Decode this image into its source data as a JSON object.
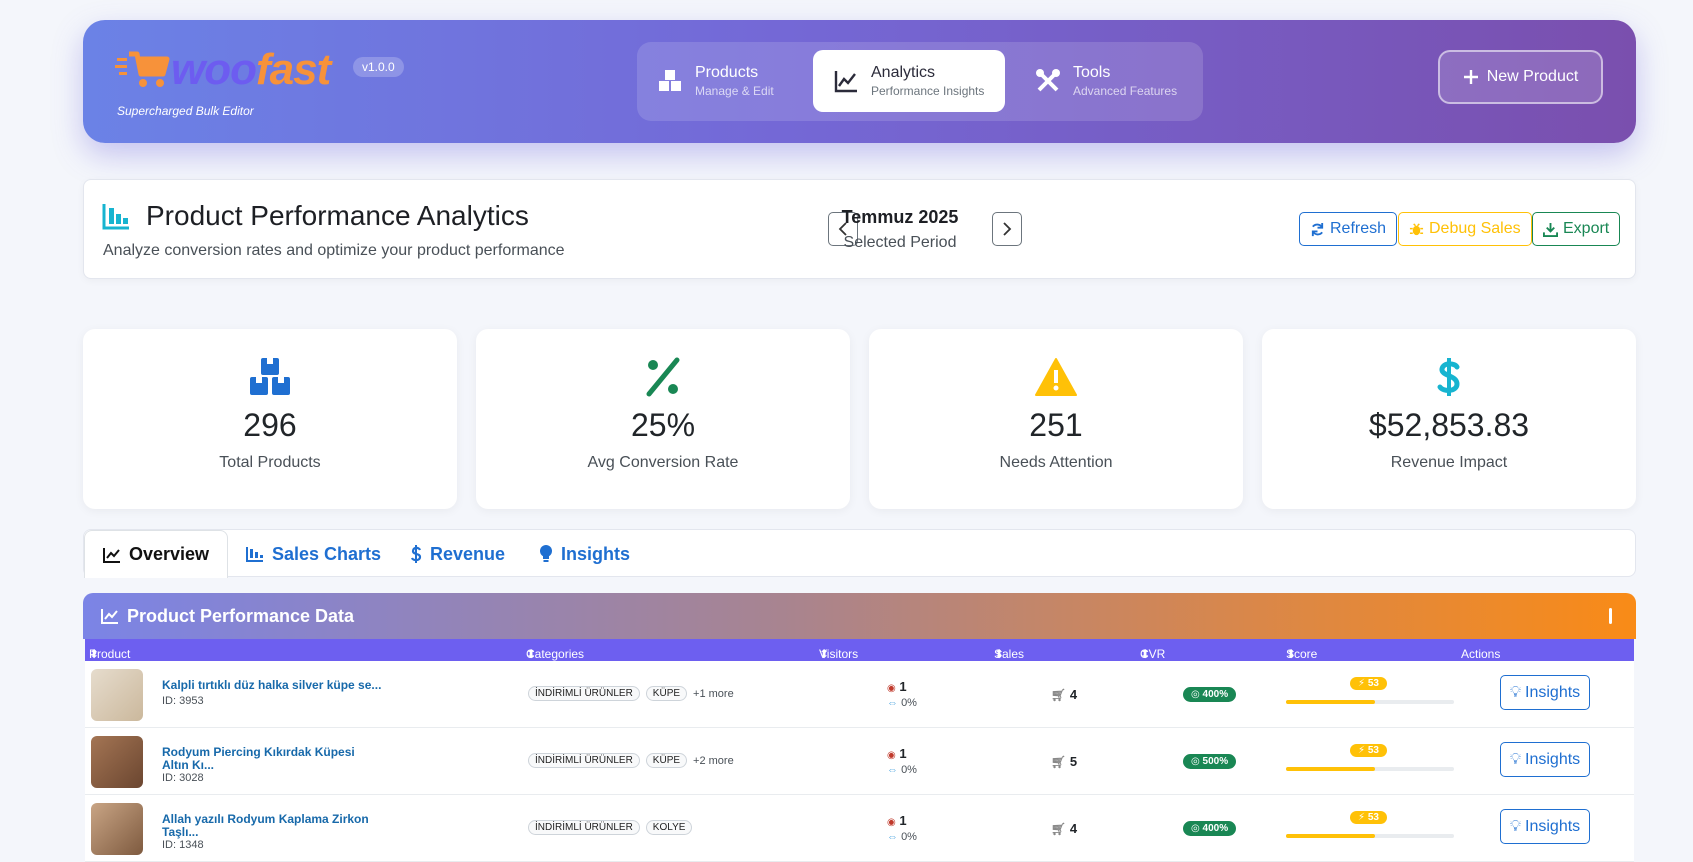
{
  "header": {
    "logo_w": "woo",
    "logo_f": "fast",
    "version": "v1.0.0",
    "tagline": "Supercharged Bulk Editor",
    "nav": [
      {
        "title": "Products",
        "sub": "Manage & Edit",
        "icon": "boxes-icon"
      },
      {
        "title": "Analytics",
        "sub": "Performance Insights",
        "icon": "line-chart-icon"
      },
      {
        "title": "Tools",
        "sub": "Advanced Features",
        "icon": "tools-icon"
      }
    ],
    "new_button": "New Product"
  },
  "panel": {
    "title": "Product Performance Analytics",
    "subtitle": "Analyze conversion rates and optimize your product performance",
    "period_month": "Temmuz 2025",
    "period_label": "Selected Period",
    "refresh": "Refresh",
    "debug": "Debug Sales",
    "export": "Export"
  },
  "stats": [
    {
      "value": "296",
      "label": "Total Products",
      "color": "#1f6fd1"
    },
    {
      "value": "25%",
      "label": "Avg Conversion Rate",
      "color": "#198754"
    },
    {
      "value": "251",
      "label": "Needs Attention",
      "color": "#ffc107"
    },
    {
      "value": "$52,853.83",
      "label": "Revenue Impact",
      "color": "#17b4d0"
    }
  ],
  "tabs": [
    "Overview",
    "Sales Charts",
    "Revenue",
    "Insights"
  ],
  "table": {
    "title": "Product Performance Data",
    "columns": [
      "Product",
      "Categories",
      "Visitors",
      "Sales",
      "CVR",
      "Score",
      "Actions"
    ],
    "rows": [
      {
        "name": "Kalpli tırtıklı düz halka silver küpe se...",
        "id": "ID: 3953",
        "cats": [
          "İNDİRİMLİ ÜRÜNLER",
          "KÜPE"
        ],
        "more": "+1 more",
        "visitors": "1",
        "visitors_change": "0%",
        "sales": "4",
        "cvr": "400%",
        "score": "53",
        "score_pct": 0.53,
        "action": "Insights"
      },
      {
        "name": "Rodyum Piercing Kıkırdak Küpesi Altın Kı...",
        "id": "ID: 3028",
        "cats": [
          "İNDİRİMLİ ÜRÜNLER",
          "KÜPE"
        ],
        "more": "+2 more",
        "visitors": "1",
        "visitors_change": "0%",
        "sales": "5",
        "cvr": "500%",
        "score": "53",
        "score_pct": 0.53,
        "action": "Insights"
      },
      {
        "name": "Allah yazılı Rodyum Kaplama Zirkon Taşlı...",
        "id": "ID: 1348",
        "cats": [
          "İNDİRİMLİ ÜRÜNLER",
          "KOLYE"
        ],
        "more": "",
        "visitors": "1",
        "visitors_change": "0%",
        "sales": "4",
        "cvr": "400%",
        "score": "53",
        "score_pct": 0.53,
        "action": "Insights"
      }
    ]
  }
}
